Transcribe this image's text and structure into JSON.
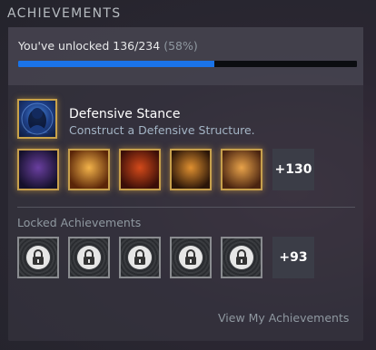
{
  "header": {
    "title": "ACHIEVEMENTS"
  },
  "progress": {
    "text": "You've unlocked 136/234",
    "percent_text": "(58%)",
    "fraction": 0.58,
    "fill_color": "#1a73e8"
  },
  "featured": {
    "title": "Defensive Stance",
    "description": "Construct a Defensive Structure."
  },
  "unlocked": {
    "icons": [
      {
        "name": "sorceress-achievement-icon",
        "colors": [
          "#6a3fa0",
          "#14102a"
        ]
      },
      {
        "name": "fire-crest-achievement-icon",
        "colors": [
          "#f3b34a",
          "#5a2508"
        ]
      },
      {
        "name": "demon-achievement-icon",
        "colors": [
          "#d44a1a",
          "#3a0e08"
        ]
      },
      {
        "name": "wizard-achievement-icon",
        "colors": [
          "#e09030",
          "#2a1508"
        ]
      },
      {
        "name": "claw-achievement-icon",
        "colors": [
          "#e9a34a",
          "#4a2410"
        ]
      }
    ],
    "more_label": "+130"
  },
  "locked": {
    "label": "Locked Achievements",
    "count_icons": 5,
    "more_label": "+93"
  },
  "footer": {
    "link_label": "View My Achievements"
  }
}
